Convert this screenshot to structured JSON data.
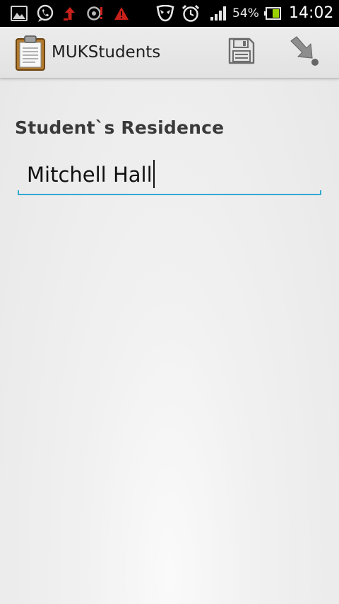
{
  "status_bar": {
    "icons": [
      "gallery-icon",
      "whatsapp-icon",
      "upload-arrow-icon",
      "chat-alert-icon",
      "warning-icon",
      "alien-icon",
      "alarm-clock-icon",
      "signal-icon",
      "battery-icon"
    ],
    "battery_percent": "54%",
    "time": "14:02"
  },
  "action_bar": {
    "app_title": "MUKStudents",
    "actions": [
      "save-icon",
      "download-icon"
    ]
  },
  "form": {
    "residence_label": "Student`s Residence",
    "residence_value": "Mitchell Hall",
    "colors": {
      "underline": "#33a9d1"
    }
  }
}
